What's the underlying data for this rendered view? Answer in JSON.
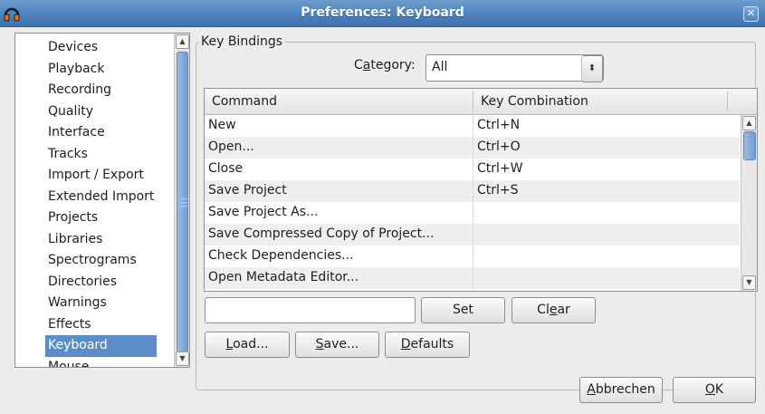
{
  "window": {
    "title": "Preferences: Keyboard",
    "close_glyph": "✕"
  },
  "sidebar": {
    "items": [
      "Devices",
      "Playback",
      "Recording",
      "Quality",
      "Interface",
      "Tracks",
      "Import / Export",
      "Extended Import",
      "Projects",
      "Libraries",
      "Spectrograms",
      "Directories",
      "Warnings",
      "Effects",
      "Keyboard",
      "Mouse"
    ],
    "selected": "Keyboard"
  },
  "key_bindings": {
    "group_label": "Key Bindings",
    "category": {
      "label_pre": "C",
      "label_u": "a",
      "label_post": "tegory:",
      "value": "All"
    },
    "columns": {
      "command": "Command",
      "key": "Key Combination"
    },
    "rows": [
      {
        "command": "New",
        "key": "Ctrl+N"
      },
      {
        "command": "Open...",
        "key": "Ctrl+O"
      },
      {
        "command": "Close",
        "key": "Ctrl+W"
      },
      {
        "command": "Save Project",
        "key": "Ctrl+S"
      },
      {
        "command": "Save Project As...",
        "key": ""
      },
      {
        "command": "Save Compressed Copy of Project...",
        "key": ""
      },
      {
        "command": "Check Dependencies...",
        "key": ""
      },
      {
        "command": "Open Metadata Editor...",
        "key": ""
      }
    ],
    "key_input_value": "",
    "set_label": "Set",
    "clear": {
      "pre": "Cl",
      "u": "e",
      "post": "ar"
    },
    "load": {
      "u": "L",
      "post": "oad..."
    },
    "save": {
      "u": "S",
      "post": "ave..."
    },
    "defaults": {
      "u": "D",
      "post": "efaults"
    }
  },
  "footer": {
    "cancel": {
      "u": "A",
      "post": "bbrechen"
    },
    "ok": {
      "u": "O",
      "post": "K"
    }
  },
  "colors": {
    "titlebar": "#4f82bd",
    "selection": "#5b8ec8"
  },
  "icons": {
    "app": "audacity-headphones-icon",
    "close": "close-icon",
    "dropdown": "chevron-updown-icon"
  }
}
